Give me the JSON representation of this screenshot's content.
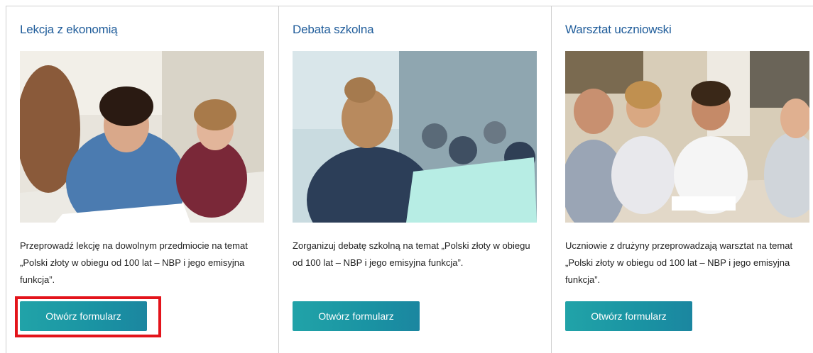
{
  "cards": [
    {
      "title": "Lekcja z ekonomią",
      "image_desc": "students writing in a classroom",
      "description": "Przeprowadź lekcję na dowolnym przedmiocie na temat „Polski złoty w obiegu od 100 lat – NBP i jego emisyjna funkcja”.",
      "button_label": "Otwórz formularz",
      "highlighted": true
    },
    {
      "title": "Debata szkolna",
      "image_desc": "speaker at a lectern facing an audience",
      "description": "Zorganizuj debatę szkolną na temat „Polski złoty w obiegu od 100 lat – NBP i jego emisyjna funkcja”.",
      "button_label": "Otwórz formularz",
      "highlighted": false
    },
    {
      "title": "Warsztat uczniowski",
      "image_desc": "group of students working together at a table",
      "description": "Uczniowie z drużyny przeprowadzają warsztat na temat „Polski złoty w obiegu od 100 lat – NBP i jego emisyjna funkcja”.",
      "button_label": "Otwórz formularz",
      "highlighted": false
    }
  ],
  "colors": {
    "title": "#1f5c9a",
    "button": "#1f9aa5",
    "highlight": "#e3141b"
  }
}
